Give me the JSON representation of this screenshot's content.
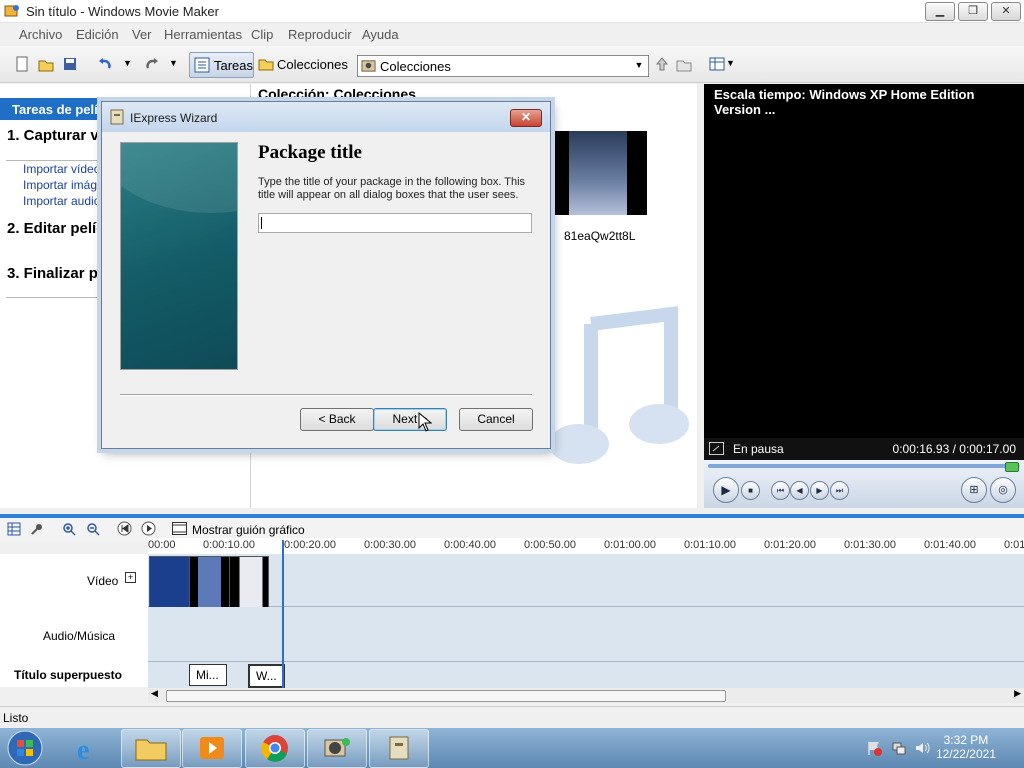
{
  "window": {
    "title": "Sin título - Windows Movie Maker",
    "minimize": "▁",
    "maximize": "❐",
    "close": "✕"
  },
  "menu": [
    "Archivo",
    "Edición",
    "Ver",
    "Herramientas",
    "Clip",
    "Reproducir",
    "Ayuda"
  ],
  "toolbar": {
    "tasks_label": "Tareas",
    "collections_label": "Colecciones",
    "collection_combo_value": "Colecciones"
  },
  "tasks_pane": {
    "header": "Tareas de pelíc",
    "section1": "1. Capturar víd",
    "links": [
      "Importar vídeo",
      "Importar imágen",
      "Importar audio d"
    ],
    "section2": "2. Editar pelíc",
    "section3": "3. Finalizar pe"
  },
  "collection": {
    "title": "Colección: Colecciones",
    "thumb_label": "81eaQw2tt8L"
  },
  "preview": {
    "title": "Escala tiempo: Windows XP Home Edition Version ...",
    "status": "En pausa",
    "time": "0:00:16.93 / 0:00:17.00",
    "progress": 0.995
  },
  "timeline": {
    "storyboard_label": "Mostrar guión gráfico",
    "ticks": [
      "00:00",
      "0:00:10.00",
      "0:00:20.00",
      "0:00:30.00",
      "0:00:40.00",
      "0:00:50.00",
      "0:01:00.00",
      "0:01:10.00",
      "0:01:20.00",
      "0:01:30.00",
      "0:01:40.00",
      "0:01"
    ],
    "tracks": {
      "video": "Vídeo",
      "audio": "Audio/Música",
      "title": "Título superpuesto"
    },
    "title_clips": [
      "Mi...",
      "W..."
    ]
  },
  "status_bar": "Listo",
  "dialog": {
    "title": "IExpress Wizard",
    "heading": "Package title",
    "description": "Type the title of your package in the following  box.  This title will appear on all dialog boxes that the user sees.",
    "input_value": "",
    "back": "< Back",
    "next": "Next >",
    "cancel": "Cancel"
  },
  "taskbar": {
    "time": "3:32 PM",
    "date": "12/22/2021"
  },
  "colors": {
    "accent": "#1f6fc7",
    "dialog_side": "#135b66",
    "timeline_track": "#dbe5f0"
  }
}
